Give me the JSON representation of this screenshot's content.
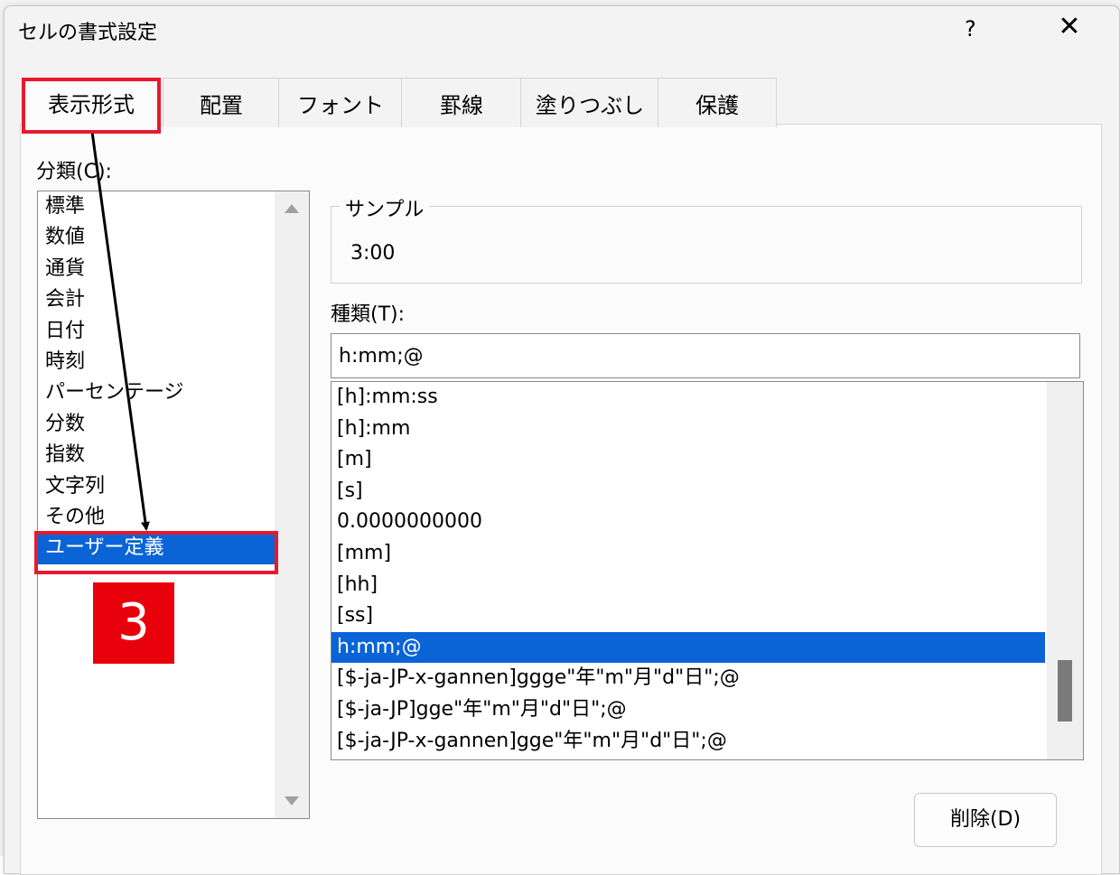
{
  "dialog": {
    "title": "セルの書式設定",
    "help_label": "?",
    "close_label": "✕"
  },
  "tabs": [
    {
      "label": "表示形式",
      "active": true
    },
    {
      "label": "配置"
    },
    {
      "label": "フォント"
    },
    {
      "label": "罫線"
    },
    {
      "label": "塗りつぶし"
    },
    {
      "label": "保護"
    }
  ],
  "category": {
    "label": "分類(C):",
    "items": [
      "標準",
      "数値",
      "通貨",
      "会計",
      "日付",
      "時刻",
      "パーセンテージ",
      "分数",
      "指数",
      "文字列",
      "その他",
      "ユーザー定義"
    ],
    "selected": "ユーザー定義"
  },
  "sample": {
    "label": "サンプル",
    "value": "3:00"
  },
  "type": {
    "label": "種類(T):",
    "value": "h:mm;@",
    "items": [
      "[h]:mm:ss",
      "[h]:mm",
      "[m]",
      "[s]",
      "0.0000000000",
      "[mm]",
      "[hh]",
      "[ss]",
      "h:mm;@",
      "[$-ja-JP-x-gannen]ggge\"年\"m\"月\"d\"日\";@",
      "[$-ja-JP]gge\"年\"m\"月\"d\"日\";@",
      "[$-ja-JP-x-gannen]gge\"年\"m\"月\"d\"日\";@"
    ],
    "selected": "h:mm;@"
  },
  "buttons": {
    "delete": "削除(D)"
  },
  "annotation": {
    "step_number": "3",
    "highlight_color": "#e8192c",
    "selection_color": "#0a64d6"
  }
}
